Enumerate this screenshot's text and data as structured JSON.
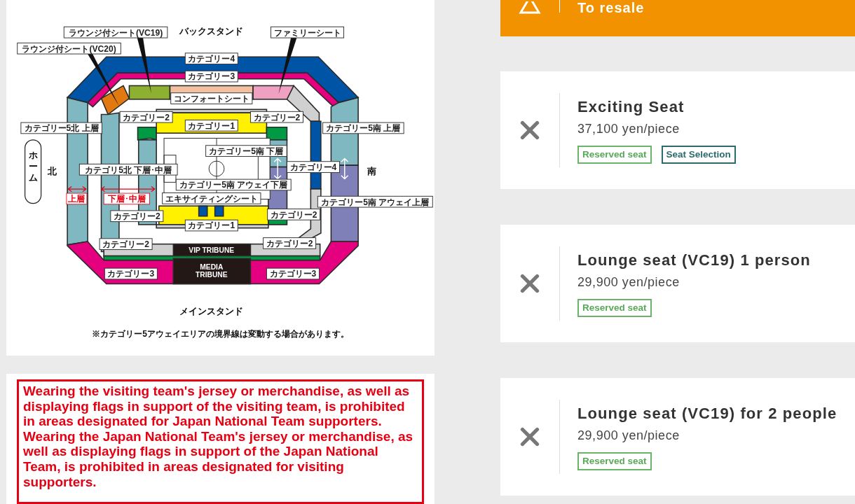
{
  "map": {
    "back_stand": "バックスタンド",
    "main_stand": "メインスタンド",
    "home": "ホーム",
    "north": "北",
    "south": "南",
    "labels": [
      "ラウンジ付シート(VC19)",
      "ラウンジ付シート(VC20)",
      "ファミリーシート",
      "カテゴリー4",
      "カテゴリー3",
      "コンフォートシート",
      "カテゴリー2",
      "カテゴリー1",
      "カテゴリー2",
      "カテゴリー5北 上層",
      "カテゴリー5南 上層",
      "カテゴリー5南 下層",
      "カテゴリ5北 下層･中層",
      "カテゴリー4",
      "カテゴリー5南 アウェイ下層",
      "エキサイティングシート",
      "カテゴリー5南 アウェイ上層",
      "カテゴリー2",
      "カテゴリー2",
      "カテゴリー1",
      "カテゴリー2",
      "カテゴリー2",
      "カテゴリー3",
      "カテゴリー3"
    ],
    "tier_labels": [
      "上層",
      "下層･中層"
    ],
    "vip_tribune": "VIP TRIBUNE",
    "media_tribune": [
      "MEDIA",
      "TRIBUNE"
    ],
    "note": "※カテゴリー5アウェイエリアの境界線は変動する場合があります。"
  },
  "warning": {
    "paragraphs": [
      "Wearing the visiting team's jersey or merchandise, as well as displaying flags in support of the visiting team, is prohibited in areas designated for Japan National Team supporters.",
      "Wearing the Japan National Team's jersey or merchandise, as well as displaying flags in support of the Japan National Team, is prohibited in areas designated for visiting supporters."
    ]
  },
  "banner": {
    "text": "To resale"
  },
  "tickets": [
    {
      "name": "Exciting Seat",
      "price": "37,100 yen/piece",
      "tags": [
        {
          "label": "Reserved seat",
          "kind": "reserved"
        },
        {
          "label": "Seat Selection",
          "kind": "selection"
        }
      ]
    },
    {
      "name": "Lounge seat (VC19) 1 person",
      "price": "29,900 yen/piece",
      "tags": [
        {
          "label": "Reserved seat",
          "kind": "reserved"
        }
      ]
    },
    {
      "name": "Lounge seat (VC19) for 2 people",
      "price": "29,900 yen/piece",
      "tags": [
        {
          "label": "Reserved seat",
          "kind": "reserved"
        }
      ]
    }
  ]
}
